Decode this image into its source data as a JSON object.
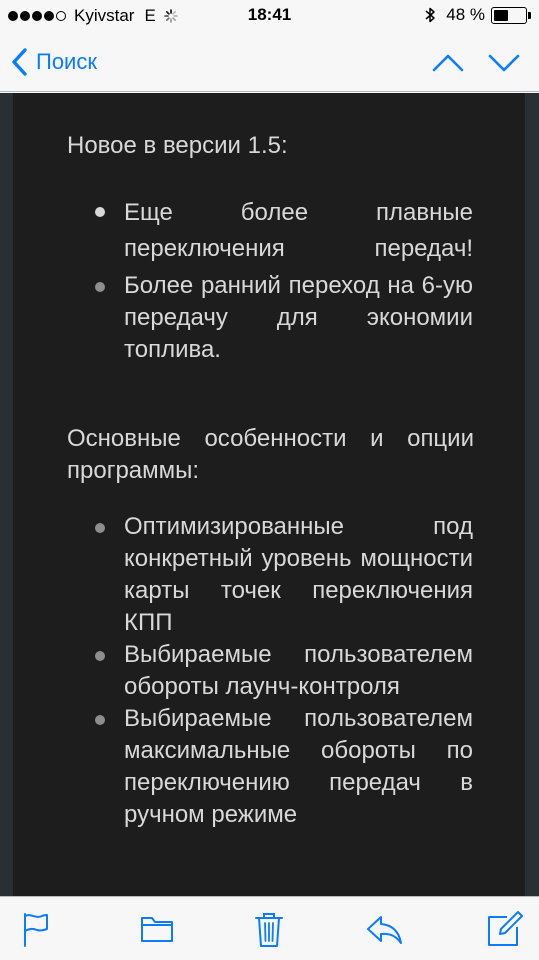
{
  "status_bar": {
    "carrier": "Kyivstar",
    "network": "E",
    "time": "18:41",
    "battery_percent": "48 %",
    "battery_level": 0.48,
    "signal_strength": 4,
    "signal_max": 5
  },
  "nav": {
    "back_label": "Поиск",
    "icons": [
      "chevron-left-icon",
      "chevron-up-icon",
      "chevron-down-icon"
    ]
  },
  "content": {
    "whats_new_title": "Новое в версии 1.5:",
    "whats_new_items": [
      "Еще более плавные переключения передач!",
      "Более ранний переход на 6-ую передачу для экономии топлива."
    ],
    "features_title": "Основные особенности и опции программы:",
    "features_items": [
      "Оптимизированные под конкретный уровень мощности карты точек переключения КПП",
      "Выбираемые пользователем обороты лаунч-контроля",
      "Выбираемые пользователем максимальные обороты по переключению передач в ручном режиме"
    ]
  },
  "toolbar": {
    "icons": [
      "flag-icon",
      "folder-icon",
      "trash-icon",
      "reply-icon",
      "compose-icon"
    ]
  },
  "colors": {
    "accent": "#0b7bff",
    "content_bg": "#1d1d1d",
    "content_text": "#d8d8d8"
  }
}
